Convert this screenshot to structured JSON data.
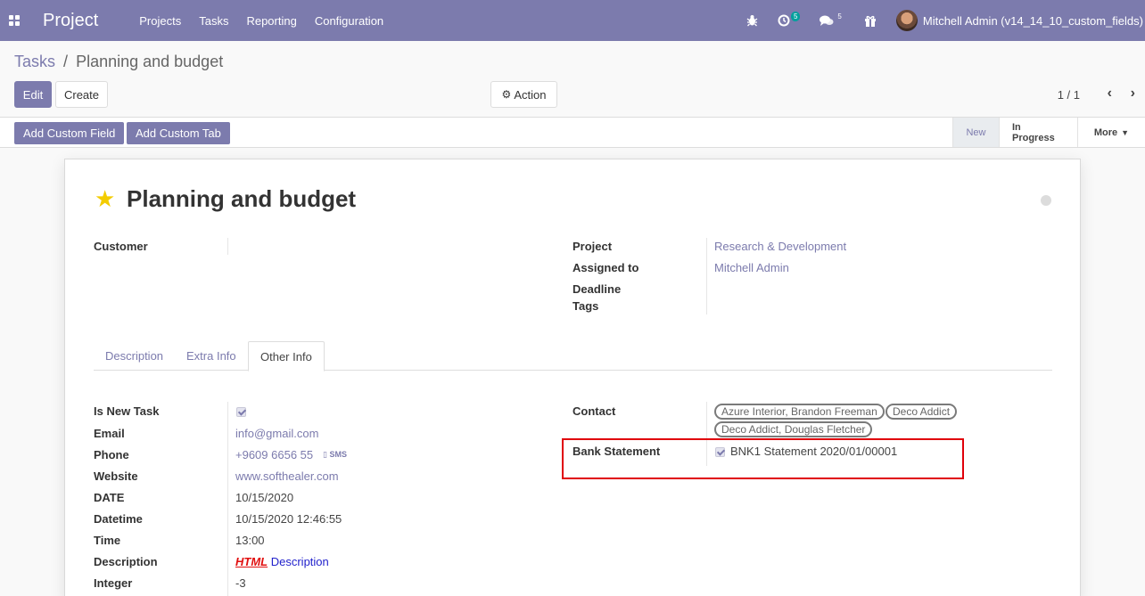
{
  "navbar": {
    "app_title": "Project",
    "menu": [
      "Projects",
      "Tasks",
      "Reporting",
      "Configuration"
    ],
    "activity_count": "5",
    "messages_count": "5",
    "user_label": "Mitchell Admin (v14_14_10_custom_fields)"
  },
  "breadcrumb": {
    "parent": "Tasks",
    "separator": "/",
    "current": "Planning and budget"
  },
  "toolbar": {
    "edit_label": "Edit",
    "create_label": "Create",
    "action_label": "Action",
    "pager": "1 / 1"
  },
  "statusbar": {
    "add_custom_field": "Add Custom Field",
    "add_custom_tab": "Add Custom Tab",
    "stages": [
      "New",
      "In Progress",
      "More"
    ]
  },
  "record": {
    "title": "Planning and budget",
    "labels": {
      "customer": "Customer",
      "project": "Project",
      "assigned_to": "Assigned to",
      "deadline": "Deadline",
      "tags": "Tags"
    },
    "project": "Research & Development",
    "assigned_to": "Mitchell Admin"
  },
  "tabs": [
    "Description",
    "Extra Info",
    "Other Info"
  ],
  "other_info": {
    "labels": {
      "is_new_task": "Is New Task",
      "email": "Email",
      "phone": "Phone",
      "website": "Website",
      "date": "DATE",
      "datetime": "Datetime",
      "time": "Time",
      "description": "Description",
      "integer": "Integer",
      "contact": "Contact",
      "bank_statement": "Bank Statement"
    },
    "email": "info@gmail.com",
    "phone": "+9609 6656 55",
    "sms_label": "SMS",
    "website": "www.softhealer.com",
    "date": "10/15/2020",
    "datetime": "10/15/2020 12:46:55",
    "time": "13:00",
    "description_html": "HTML",
    "description_text": "Description",
    "integer": "-3",
    "contacts": [
      "Azure Interior, Brandon Freeman",
      "Deco Addict",
      "Deco Addict, Douglas Fletcher"
    ],
    "bank_statement": "BNK1 Statement 2020/01/00001"
  },
  "colors": {
    "primary": "#7c7bad",
    "highlight": "#e0000a",
    "star": "#f3cc00"
  }
}
